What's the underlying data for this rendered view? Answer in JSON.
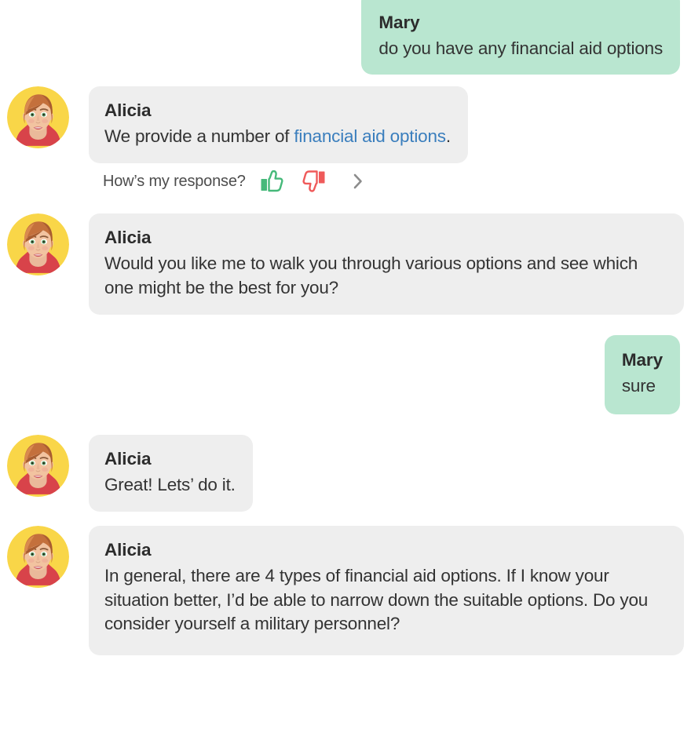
{
  "theme": {
    "page_background": "#ffffff",
    "agent_bubble_color": "#eeeeee",
    "user_bubble_color": "#b9e6d0",
    "link_color": "#3a7ebd",
    "text_color": "#333333",
    "thumbs_up_color": "#46b97a",
    "thumbs_down_color": "#ef5a5a",
    "chevron_color": "#8c8c8c",
    "avatar_background": "#f9d648"
  },
  "participants": {
    "agent_name": "Alicia",
    "user_name": "Mary"
  },
  "messages": [
    {
      "id": "msg-1",
      "sender": "Mary",
      "side": "outgoing",
      "text": "do you have any financial aid options"
    },
    {
      "id": "msg-2",
      "sender": "Alicia",
      "side": "incoming",
      "text_before_link": "We provide a number of ",
      "link_text": "financial aid options",
      "text_after_link": "."
    },
    {
      "id": "msg-3",
      "sender": "Alicia",
      "side": "incoming",
      "text": "Would you like me to walk you through various options and see which one might be the best for you?"
    },
    {
      "id": "msg-4",
      "sender": "Mary",
      "side": "outgoing",
      "text": "sure"
    },
    {
      "id": "msg-5",
      "sender": "Alicia",
      "side": "incoming",
      "text": "Great! Lets’ do it."
    },
    {
      "id": "msg-6",
      "sender": "Alicia",
      "side": "incoming",
      "text": "In general, there are 4 types of financial aid options. If I know your situation better, I’d be able to narrow down the suitable options. Do you consider yourself a military personnel?"
    }
  ],
  "feedback": {
    "prompt": "How’s my response?",
    "thumbs_up_icon": "thumbs-up-icon",
    "thumbs_down_icon": "thumbs-down-icon",
    "next_icon": "chevron-right-icon"
  },
  "icons": {
    "avatar": "agent-avatar-alicia"
  }
}
